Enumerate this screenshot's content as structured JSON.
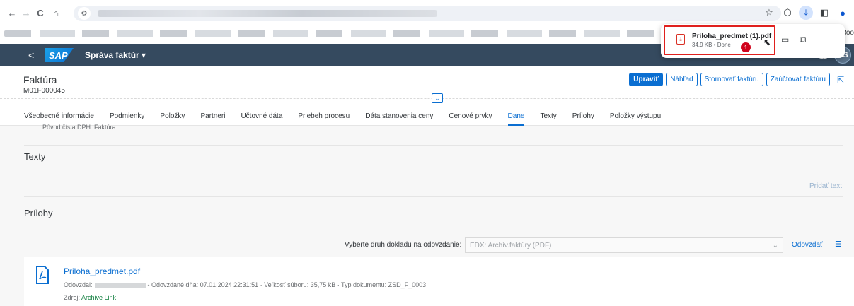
{
  "browser": {
    "nav": {
      "back": "←",
      "forward": "→",
      "reload": "C",
      "home": "⌂"
    },
    "bookmarks_all": "All Boo",
    "downloads": {
      "file_name": "Priloha_predmet (1).pdf",
      "status": "34.9 KB • Done",
      "badge": "1"
    }
  },
  "shell": {
    "back": "<",
    "logo": "SAP",
    "app_title": "Správa faktúr ▾",
    "avatar": "KS"
  },
  "header": {
    "title": "Faktúra",
    "id": "M01F000045",
    "actions": [
      "Upraviť",
      "Náhľad",
      "Stornovať faktúru",
      "Zaúčtovať faktúru"
    ]
  },
  "tabs": [
    {
      "label": "Všeobecné informácie"
    },
    {
      "label": "Podmienky"
    },
    {
      "label": "Položky"
    },
    {
      "label": "Partneri"
    },
    {
      "label": "Účtovné dáta"
    },
    {
      "label": "Priebeh procesu"
    },
    {
      "label": "Dáta stanovenia ceny"
    },
    {
      "label": "Cenové prvky"
    },
    {
      "label": "Dane",
      "selected": true
    },
    {
      "label": "Texty"
    },
    {
      "label": "Prílohy"
    },
    {
      "label": "Položky výstupu"
    }
  ],
  "content": {
    "cut_row": "Pôvod čísla DPH:  Faktúra",
    "texts_title": "Texty",
    "add_text": "Pridať text",
    "attachments_title": "Prílohy",
    "download_label": "Vyberte druh dokladu na odovzdanie:",
    "download_select": "EDX: Archív.faktúry (PDF)",
    "download_button": "Odovzdať",
    "attachment": {
      "name": "Priloha_predmet.pdf",
      "uploaded_by_label": "Odovzdal:",
      "meta": "- Odovzdané dňa: 07.01.2024 22:31:51 · Veľkosť súboru: 35,75 kB · Typ dokumentu: ZSD_F_0003",
      "source_label": "Zdroj:",
      "source_value": "Archive Link"
    }
  }
}
